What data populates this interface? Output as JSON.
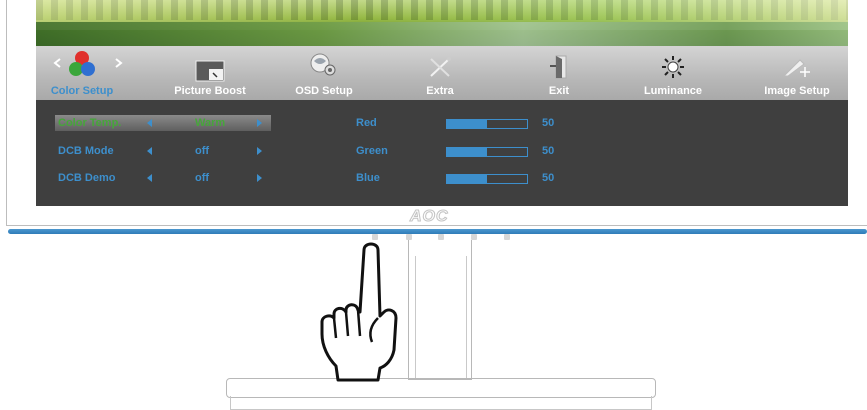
{
  "tabs": [
    {
      "label": "Color Setup",
      "icon": "rgb-circles-icon",
      "active": true
    },
    {
      "label": "Picture Boost",
      "icon": "picture-boost-icon",
      "active": false
    },
    {
      "label": "OSD Setup",
      "icon": "osd-setup-icon",
      "active": false
    },
    {
      "label": "Extra",
      "icon": "tools-icon",
      "active": false
    },
    {
      "label": "Exit",
      "icon": "exit-door-icon",
      "active": false
    },
    {
      "label": "Luminance",
      "icon": "sun-icon",
      "active": false
    },
    {
      "label": "Image Setup",
      "icon": "image-setup-icon",
      "active": false
    }
  ],
  "settings": [
    {
      "label": "Color Temp.",
      "value": "Warm",
      "selected": true
    },
    {
      "label": "DCB Mode",
      "value": "off",
      "selected": false
    },
    {
      "label": "DCB Demo",
      "value": "off",
      "selected": false
    }
  ],
  "sliders": [
    {
      "label": "Red",
      "value": 50
    },
    {
      "label": "Green",
      "value": 50
    },
    {
      "label": "Blue",
      "value": 50
    }
  ],
  "brand": "AOC",
  "colors": {
    "accent": "#3d8fcc",
    "selected_text": "#46a63a",
    "panel": "#3f3f3f"
  }
}
